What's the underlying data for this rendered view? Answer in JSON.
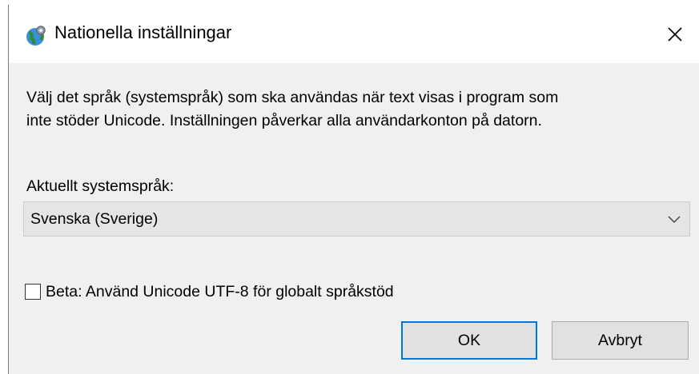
{
  "window": {
    "title": "Nationella inställningar",
    "icon": "globe-settings-icon",
    "close_icon": "close-icon"
  },
  "description": {
    "line1": "Välj det språk (systemspråk) som ska användas när text visas i program som",
    "line2": "inte stöder Unicode. Inställningen påverkar alla användarkonton på datorn."
  },
  "system_locale": {
    "label": "Aktuellt systemspråk:",
    "selected": "Svenska (Sverige)"
  },
  "utf8_option": {
    "label": "Beta: Använd Unicode UTF-8 för globalt språkstöd",
    "checked": false
  },
  "buttons": {
    "ok": "OK",
    "cancel": "Avbryt"
  },
  "colors": {
    "accent": "#0078d7",
    "dialog_background": "#f0f0f0"
  }
}
